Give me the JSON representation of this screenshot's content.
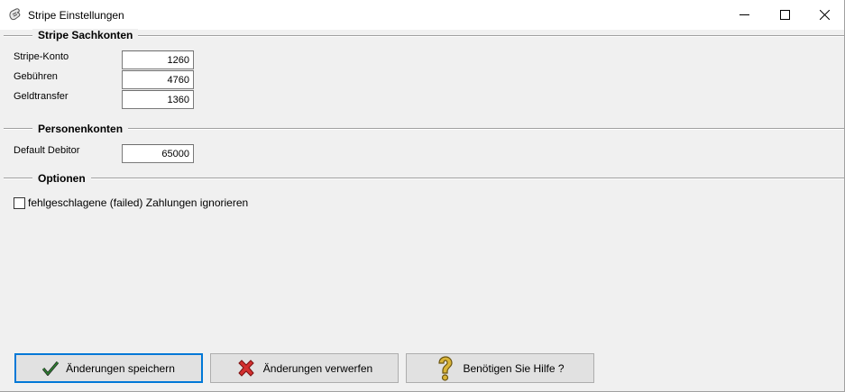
{
  "window": {
    "title": "Stripe Einstellungen",
    "icon": "stripe-app-icon",
    "controls": [
      "minimize-icon",
      "maximize-icon",
      "close-icon"
    ]
  },
  "sections": {
    "sachkonten": {
      "title": "Stripe Sachkonten",
      "fields": [
        {
          "label": "Stripe-Konto",
          "value": "1260"
        },
        {
          "label": "Gebühren",
          "value": "4760"
        },
        {
          "label": "Geldtransfer",
          "value": "1360"
        }
      ]
    },
    "personenkonten": {
      "title": "Personenkonten",
      "fields": [
        {
          "label": "Default Debitor",
          "value": "65000"
        }
      ]
    },
    "optionen": {
      "title": "Optionen",
      "checkbox_label": "fehlgeschlagene (failed) Zahlungen ignorieren",
      "checkbox_checked": false
    }
  },
  "buttons": {
    "save_label": "Änderungen speichern",
    "discard_label": "Änderungen verwerfen",
    "help_label": "Benötigen Sie Hilfe ?"
  },
  "colors": {
    "accent": "#0078d7",
    "save_check": "#2e7d32",
    "discard_x": "#d32f2f",
    "help_question": "#c9a227"
  }
}
